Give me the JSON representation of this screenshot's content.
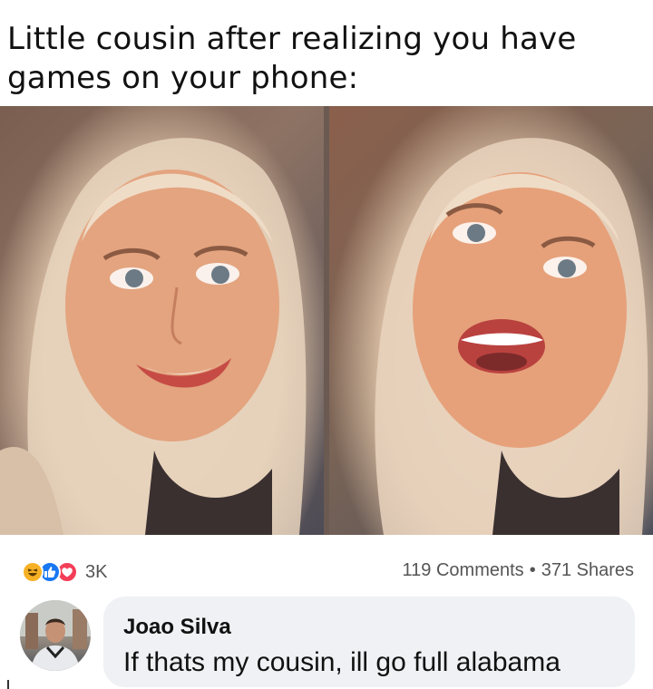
{
  "caption": "Little cousin after realizing you have games on your phone:",
  "photos": {
    "left": "smiling-woman-photo",
    "right": "excited-woman-photo"
  },
  "reactions": {
    "icons": [
      "haha-icon",
      "like-icon",
      "love-icon"
    ],
    "count": "3K",
    "colors": {
      "haha": "#f7b125",
      "like": "#1877f2",
      "love": "#f33e58"
    }
  },
  "stats": {
    "comments": "119 Comments",
    "separator": "•",
    "shares": "371 Shares"
  },
  "comment": {
    "author": "Joao Silva",
    "text": "If thats my cousin, ill go full alabama"
  }
}
